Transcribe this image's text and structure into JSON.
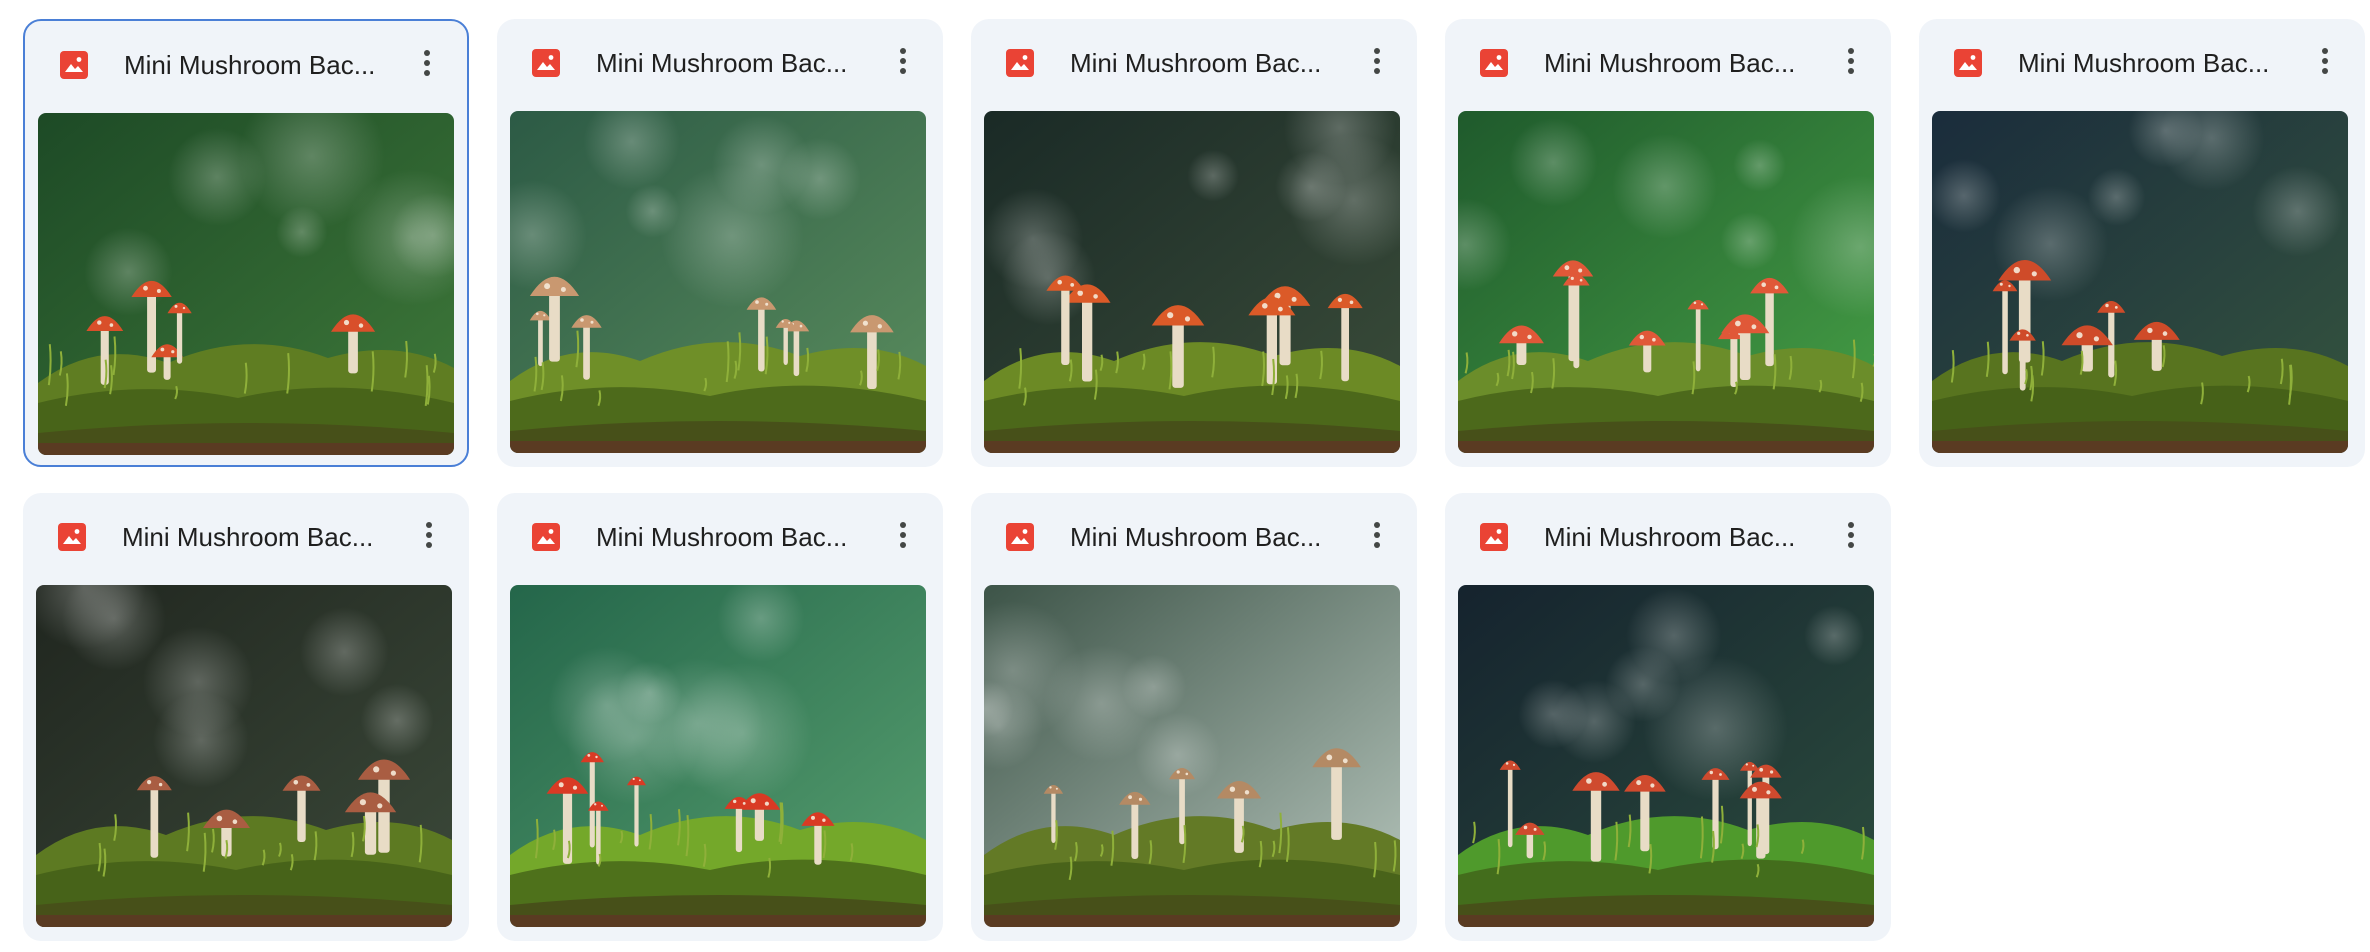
{
  "files": [
    {
      "name": "Mini Mushroom Bac...",
      "selected": true,
      "icon": "image-file-icon",
      "palette": {
        "bg1": "#1d4a26",
        "bg2": "#3f7a3a",
        "moss": "#5f7d22",
        "cap": "#d94f2a"
      }
    },
    {
      "name": "Mini Mushroom Bac...",
      "selected": false,
      "icon": "image-file-icon",
      "palette": {
        "bg1": "#2c5a45",
        "bg2": "#5b8e5e",
        "moss": "#6f8f28",
        "cap": "#c99870"
      }
    },
    {
      "name": "Mini Mushroom Bac...",
      "selected": false,
      "icon": "image-file-icon",
      "palette": {
        "bg1": "#1a2a26",
        "bg2": "#3b4d3a",
        "moss": "#6c8a25",
        "cap": "#db5a28"
      }
    },
    {
      "name": "Mini Mushroom Bac...",
      "selected": false,
      "icon": "image-file-icon",
      "palette": {
        "bg1": "#1f5a2c",
        "bg2": "#46a046",
        "moss": "#6b8d2a",
        "cap": "#e05838"
      }
    },
    {
      "name": "Mini Mushroom Bac...",
      "selected": false,
      "icon": "image-file-icon",
      "palette": {
        "bg1": "#1a2c3c",
        "bg2": "#35553f",
        "moss": "#58741f",
        "cap": "#cf4b29"
      }
    },
    {
      "name": "Mini Mushroom Bac...",
      "selected": false,
      "icon": "image-file-icon",
      "palette": {
        "bg1": "#20261f",
        "bg2": "#3c4a3a",
        "moss": "#5d7a22",
        "cap": "#a95d42"
      }
    },
    {
      "name": "Mini Mushroom Bac...",
      "selected": false,
      "icon": "image-file-icon",
      "palette": {
        "bg1": "#24664a",
        "bg2": "#58a070",
        "moss": "#74a82a",
        "cap": "#d93a24"
      }
    },
    {
      "name": "Mini Mushroom Bac...",
      "selected": false,
      "icon": "image-file-icon",
      "palette": {
        "bg1": "#3d5448",
        "bg2": "#b7c6bd",
        "moss": "#637a26",
        "cap": "#b48a64"
      }
    },
    {
      "name": "Mini Mushroom Bac...",
      "selected": false,
      "icon": "image-file-icon",
      "palette": {
        "bg1": "#15232e",
        "bg2": "#2c4d3e",
        "moss": "#4f9a2c",
        "cap": "#cf4a2e"
      }
    }
  ],
  "icons": {
    "file": "image-file-icon",
    "more": "more-vertical-icon"
  }
}
